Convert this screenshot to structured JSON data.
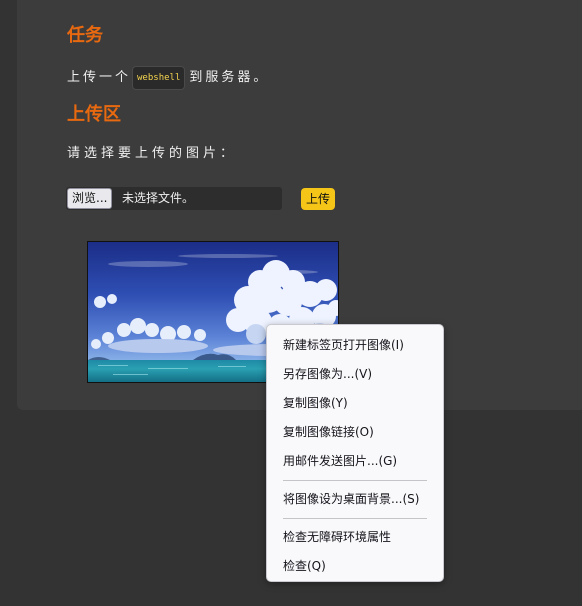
{
  "task": {
    "heading": "任务",
    "description_before": "上传一个",
    "code_tag": "webshell",
    "description_after": "到服务器。"
  },
  "upload": {
    "heading": "上传区",
    "prompt": "请选择要上传的图片：",
    "browse_label": "浏览...",
    "file_status": "未选择文件。",
    "submit_label": "上传"
  },
  "context_menu": {
    "items": [
      "新建标签页打开图像(I)",
      "另存图像为...(V)",
      "复制图像(Y)",
      "复制图像链接(O)",
      "用邮件发送图片...(G)",
      "将图像设为桌面背景...(S)",
      "检查无障碍环境属性",
      "检查(Q)"
    ]
  },
  "colors": {
    "page_background": "#333333",
    "panel_background": "#3c3c3c",
    "heading_orange": "#e8690f",
    "button_yellow": "#f5c518",
    "code_yellow": "#f4d44e"
  }
}
